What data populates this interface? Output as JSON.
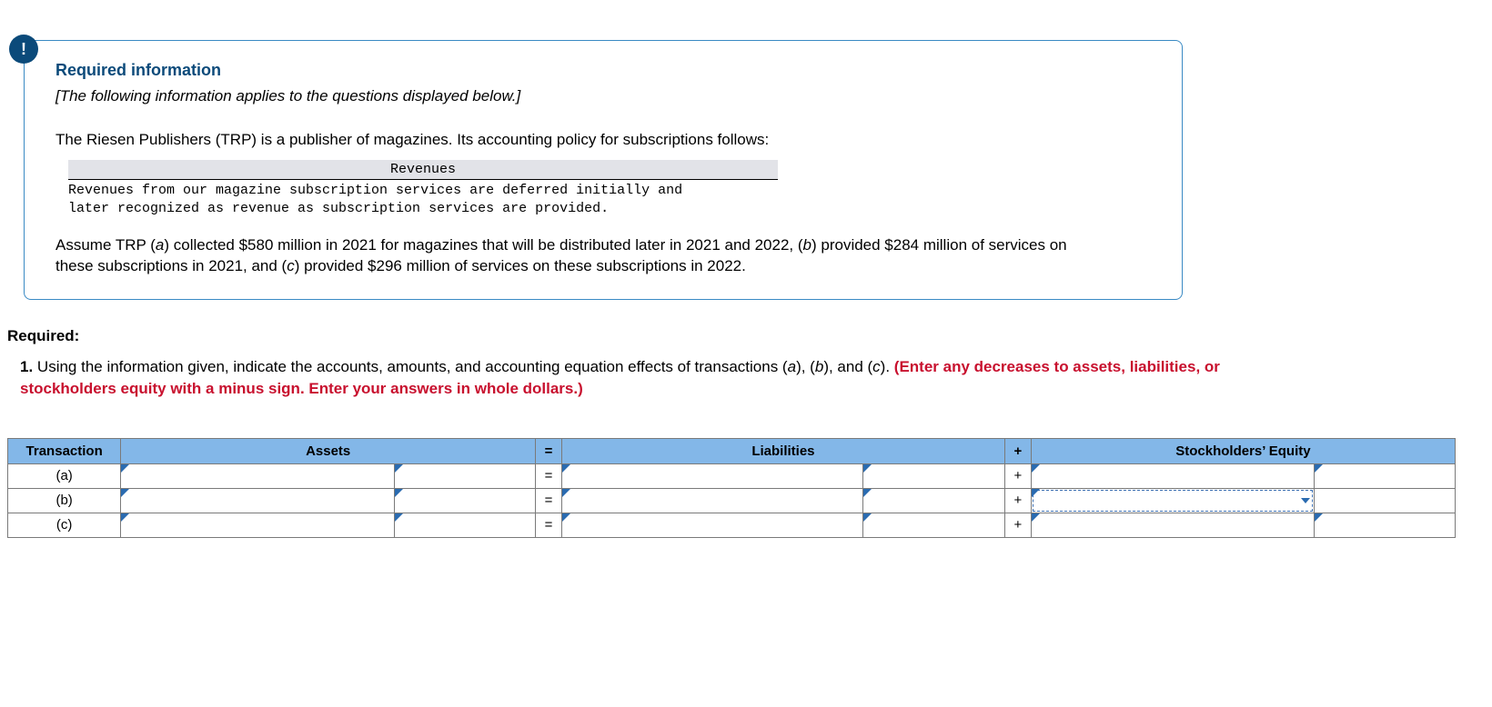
{
  "alert_icon": "!",
  "info": {
    "title": "Required information",
    "subtitle": "[The following information applies to the questions displayed below.]",
    "intro": "The Riesen Publishers (TRP) is a publisher of magazines. Its accounting policy for subscriptions follows:",
    "policy_header": "Revenues",
    "policy_body": "Revenues from our magazine subscription services are deferred initially and\nlater recognized as revenue as subscription services are provided.",
    "assume_pre": "Assume TRP (",
    "assume_a": "a",
    "assume_a_txt": ") collected $580 million in 2021 for magazines that will be distributed later in 2021 and 2022, (",
    "assume_b": "b",
    "assume_b_txt": ") provided $284 million of services on these subscriptions in 2021, and (",
    "assume_c": "c",
    "assume_c_txt": ") provided $296 million of services on these subscriptions in 2022."
  },
  "required": {
    "heading": "Required:",
    "num": "1.",
    "q_pre": " Using the information given, indicate the accounts, amounts, and accounting equation effects of transactions (",
    "q_a": "a",
    "q_mid1": "), (",
    "q_b": "b",
    "q_mid2": "), and (",
    "q_c": "c",
    "q_post": "). ",
    "red": "(Enter any decreases to assets, liabilities, or stockholders equity with a minus sign. Enter your answers in whole dollars.)"
  },
  "table": {
    "headers": {
      "transaction": "Transaction",
      "assets": "Assets",
      "eq": "=",
      "liabilities": "Liabilities",
      "plus": "+",
      "equity": "Stockholders’ Equity"
    },
    "rows": [
      {
        "label": "(a)",
        "eq": "=",
        "plus": "+"
      },
      {
        "label": "(b)",
        "eq": "=",
        "plus": "+",
        "equity_focused": true
      },
      {
        "label": "(c)",
        "eq": "=",
        "plus": "+"
      }
    ]
  }
}
